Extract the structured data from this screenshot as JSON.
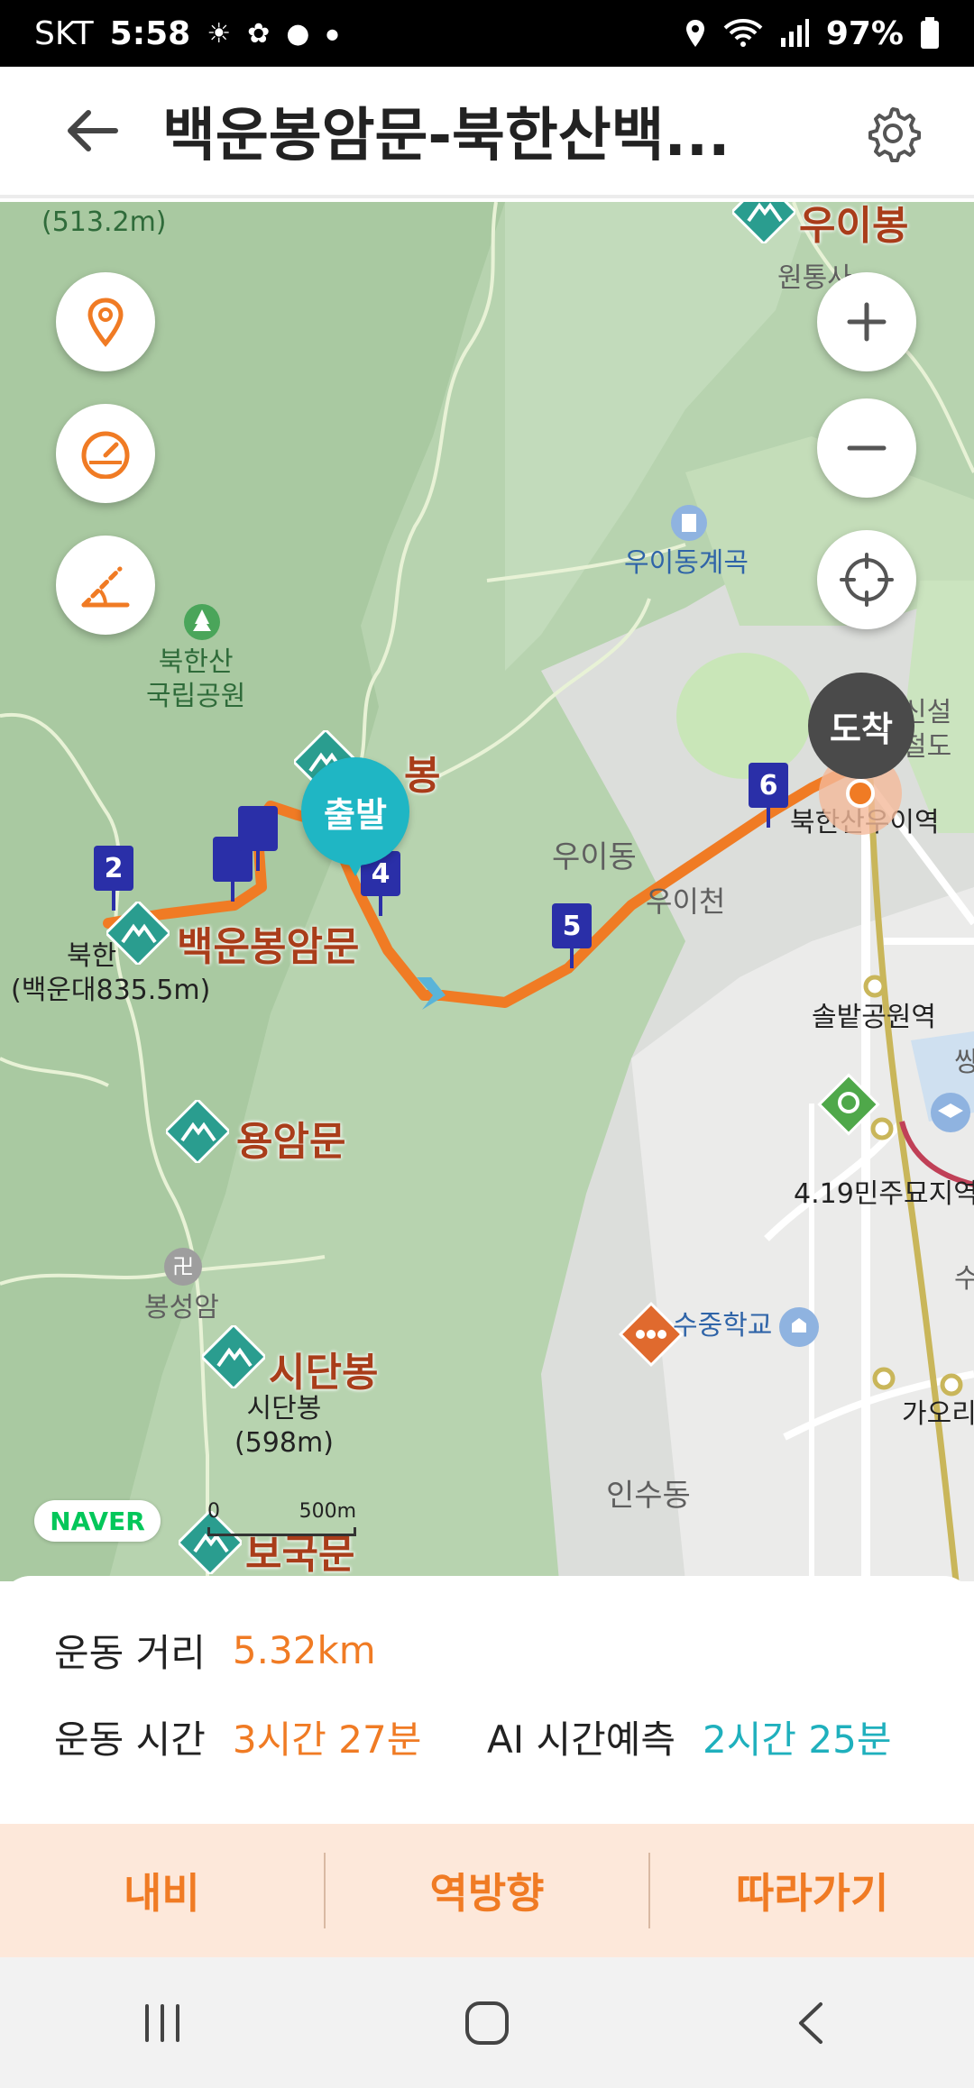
{
  "status_bar": {
    "carrier": "SKT",
    "time": "5:58",
    "battery": "97%",
    "icons": [
      "sun-icon",
      "app-icon",
      "chat-icon",
      "dot-icon",
      "location-icon",
      "wifi-icon",
      "signal-icon",
      "battery-icon"
    ]
  },
  "header": {
    "title": "백운봉암문-북한산백..."
  },
  "map": {
    "labels": {
      "top_left_elevation": "(513.2m)",
      "uibong": "우이봉",
      "wontongsa": "원통사",
      "uidong_valley": "우이동계곡",
      "park": "북한산\n국립공원",
      "bong": "봉",
      "uidong": "우이동",
      "uicheon": "우이천",
      "station_uiyeok": "북한산우이역",
      "sinseol": "신설\n철도",
      "baegundae_short": "북한",
      "baegundae": "(백운대835.5m)",
      "baegunbong_ammun": "백운봉암문",
      "yongammun": "용암문",
      "bongseongam": "봉성암",
      "sidanbong": "시단봉",
      "sidanbong_sub": "시단봉\n(598m)",
      "bogungmun": "보국문",
      "solbat": "솔밭공원역",
      "memorial": "4.19민주묘지역",
      "school": "수중학교",
      "gaori": "가오리",
      "insudong": "인수동",
      "ssang": "쌍",
      "su": "수"
    },
    "start_label": "출발",
    "end_label": "도착",
    "waypoints": [
      "2",
      "4",
      "5",
      "6"
    ],
    "logo": "NAVER",
    "scale": {
      "start": "0",
      "end": "500m"
    }
  },
  "stats": {
    "distance_label": "운동 거리",
    "distance_value": "5.32km",
    "time_label": "운동 시간",
    "time_value": "3시간 27분",
    "ai_label": "AI 시간예측",
    "ai_value": "2시간 25분"
  },
  "actions": {
    "navigate": "내비",
    "reverse": "역방향",
    "follow": "따라가기"
  },
  "colors": {
    "route": "#f07b24",
    "start": "#1fb6c4",
    "waypoint": "#2a2fa8",
    "peak": "#2a9d8f"
  }
}
